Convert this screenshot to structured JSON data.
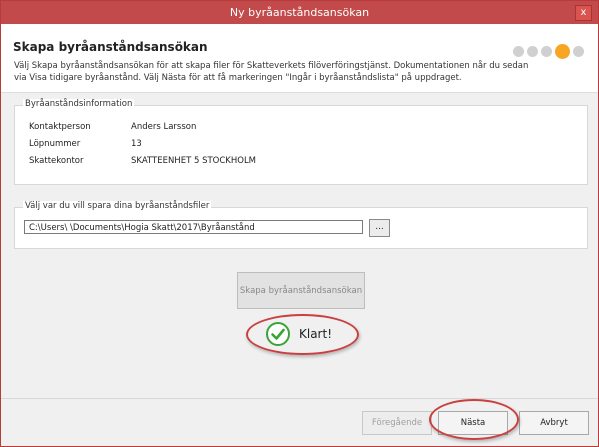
{
  "window": {
    "title": "Ny byråanståndsansökan",
    "close_symbol": "x"
  },
  "header": {
    "title": "Skapa byråanståndsansökan",
    "description": "Välj Skapa byråanståndsansökan för att skapa filer för Skatteverkets filöverföringstjänst. Dokumentationen når du sedan via Visa tidigare byråanstånd. Välj Nästa för att få markeringen \"Ingår i byråanståndslista\" på uppdraget.",
    "steps": {
      "count": 5,
      "active_index": 4,
      "active_color": "#f6a623"
    }
  },
  "info_group": {
    "legend": "Byråanståndsinformation",
    "rows": [
      {
        "label": "Kontaktperson",
        "value": "Anders Larsson"
      },
      {
        "label": "Löpnummer",
        "value": "13"
      },
      {
        "label": "Skattekontor",
        "value": "SKATTEENHET 5 STOCKHOLM"
      }
    ]
  },
  "path_group": {
    "legend": "Välj var du vill spara dina byråanståndsfiler",
    "path_value": "C:\\Users\\                       \\Documents\\Hogia Skatt\\2017\\Byråanstånd",
    "browse_label": "..."
  },
  "create_button": {
    "label": "Skapa byråanståndsansökan"
  },
  "status": {
    "text": "Klart!"
  },
  "footer": {
    "prev_label": "Föregående",
    "next_label": "Nästa",
    "cancel_label": "Avbryt"
  },
  "colors": {
    "titlebar": "#c24a4a",
    "annotation": "#c94040",
    "success": "#3aa335"
  }
}
